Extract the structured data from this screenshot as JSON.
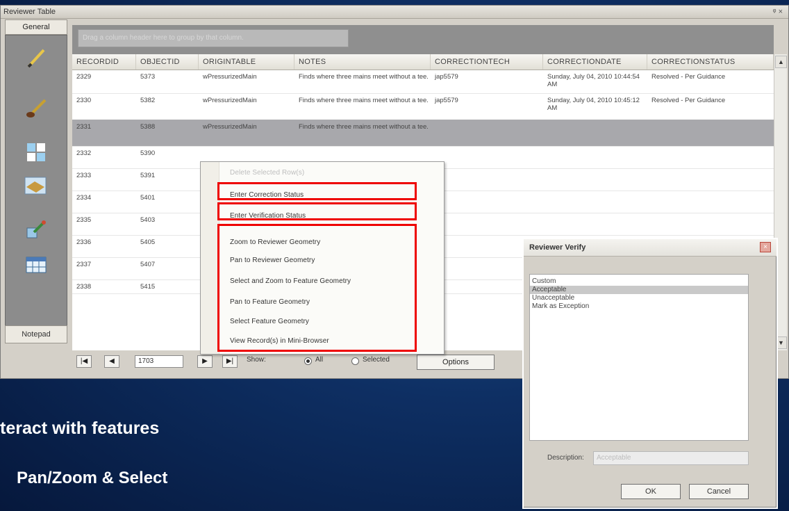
{
  "window": {
    "title": "Reviewer Table",
    "pin": "ᵠ ×"
  },
  "sidebar": {
    "general_tab": "General",
    "notepad_tab": "Notepad"
  },
  "groupbar": {
    "placeholder": "Drag a column header here to group by that column."
  },
  "table": {
    "columns": [
      "RECORDID",
      "OBJECTID",
      "ORIGINTABLE",
      "NOTES",
      "CORRECTIONTECH",
      "CORRECTIONDATE",
      "CORRECTIONSTATUS"
    ],
    "rows": [
      [
        "2329",
        "5373",
        "wPressurizedMain",
        "Finds where three mains meet without a tee.",
        "jap5579",
        "Sunday, July 04, 2010 10:44:54 AM",
        "Resolved - Per Guidance"
      ],
      [
        "2330",
        "5382",
        "wPressurizedMain",
        "Finds where three mains meet without a tee.",
        "jap5579",
        "Sunday, July 04, 2010 10:45:12 AM",
        "Resolved - Per Guidance"
      ],
      [
        "2331",
        "5388",
        "wPressurizedMain",
        "Finds where three mains meet without a tee.",
        "",
        "",
        ""
      ],
      [
        "2332",
        "5390",
        "",
        "",
        "",
        "",
        ""
      ],
      [
        "2333",
        "5391",
        "",
        "",
        "",
        "",
        ""
      ],
      [
        "2334",
        "5401",
        "",
        "",
        "",
        "",
        ""
      ],
      [
        "2335",
        "5403",
        "",
        "",
        "",
        "",
        ""
      ],
      [
        "2336",
        "5405",
        "",
        "",
        "",
        "",
        ""
      ],
      [
        "2337",
        "5407",
        "",
        "",
        "",
        "",
        ""
      ],
      [
        "2338",
        "5415",
        "",
        "",
        "",
        "",
        ""
      ]
    ]
  },
  "nav": {
    "record": "1703",
    "show_label": "Show:",
    "all_label": "All",
    "selected_label": "Selected",
    "options_label": "Options",
    "show_all_selected": true
  },
  "context_menu": {
    "items": [
      "Delete Selected Row(s)",
      "Enter Correction Status",
      "Enter Verification Status",
      "Zoom to Reviewer Geometry",
      "Pan to Reviewer Geometry",
      "Select and Zoom to Feature Geometry",
      "Pan to Feature Geometry",
      "Select Feature Geometry",
      "View Record(s) in Mini-Browser"
    ],
    "disabled": [
      true,
      false,
      false,
      false,
      false,
      false,
      false,
      false,
      false
    ]
  },
  "dialog": {
    "title": "Reviewer Verify",
    "options": [
      "Custom",
      "Acceptable",
      "Unacceptable",
      "Mark as Exception"
    ],
    "selected": "Acceptable",
    "description_label": "Description:",
    "description_value": "Acceptable",
    "ok_label": "OK",
    "cancel_label": "Cancel"
  },
  "slide": {
    "heading": "teract with features",
    "subheading": "Pan/Zoom & Select"
  },
  "colors": {
    "highlight": "#ee0000",
    "selected_row": "#a8a8ac",
    "background": "#0e2f63"
  }
}
